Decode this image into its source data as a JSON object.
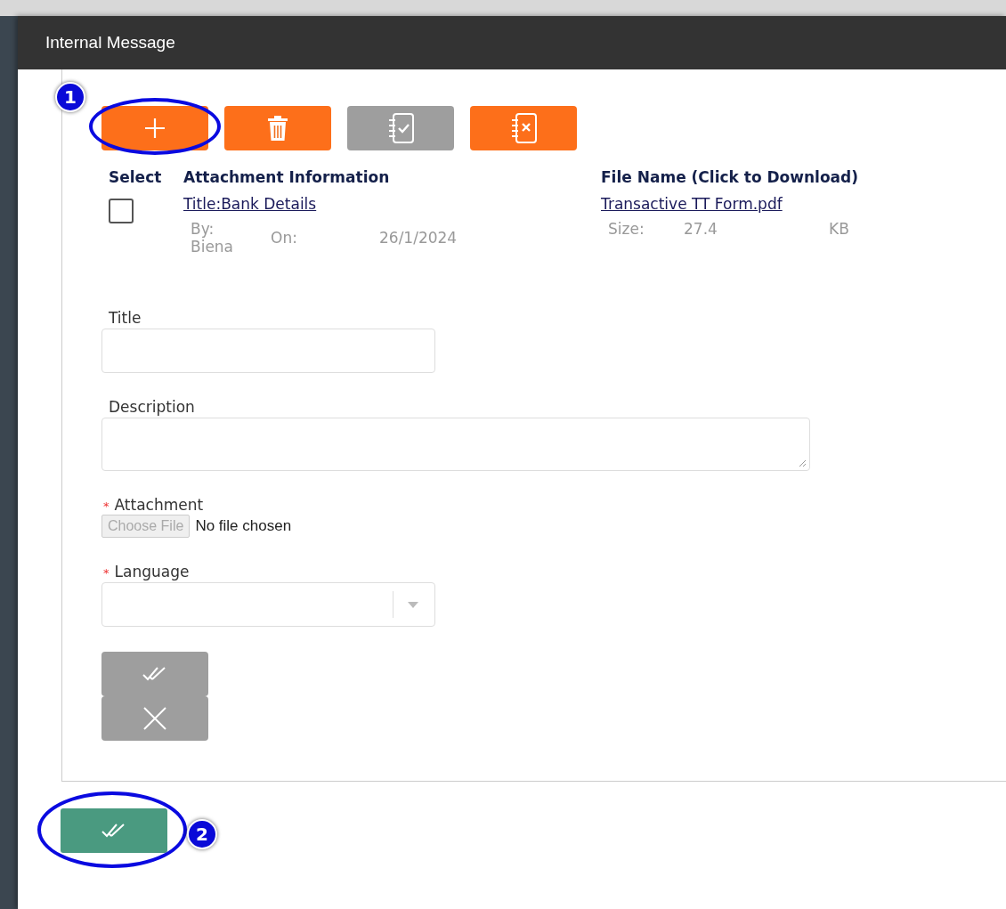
{
  "window": {
    "title": "Internal Message"
  },
  "toolbar": [
    {
      "kind": "add",
      "disabled": false,
      "callout": "1"
    },
    {
      "kind": "delete",
      "disabled": false
    },
    {
      "kind": "select-all",
      "disabled": true
    },
    {
      "kind": "deselect-all",
      "disabled": false
    }
  ],
  "attachments": {
    "columns": [
      "Select",
      "Attachment Information",
      "File Name (Click to Download)"
    ],
    "rows": [
      {
        "checked": false,
        "title": "Title:Bank Details",
        "by_label": "By:",
        "by": "Biena",
        "on_label": "On:",
        "date": "26/1/2024",
        "file": "Transactive TT Form.pdf",
        "size_label": "Size:",
        "size": "27.4",
        "unit": "KB"
      }
    ]
  },
  "form": {
    "fields": [
      {
        "kind": "text",
        "label": "Title"
      },
      {
        "kind": "textarea",
        "label": "Description"
      },
      {
        "kind": "file",
        "label": "Attachment",
        "required_marker": "*",
        "button": "Choose File",
        "value": "No file chosen"
      },
      {
        "kind": "select",
        "label": "Language",
        "required_marker": "*"
      }
    ],
    "buttons": [
      {
        "kind": "save",
        "disabled": true
      },
      {
        "kind": "cancel",
        "disabled": true
      }
    ]
  },
  "footer_button": {
    "kind": "save",
    "disabled": false,
    "callout": "2"
  }
}
